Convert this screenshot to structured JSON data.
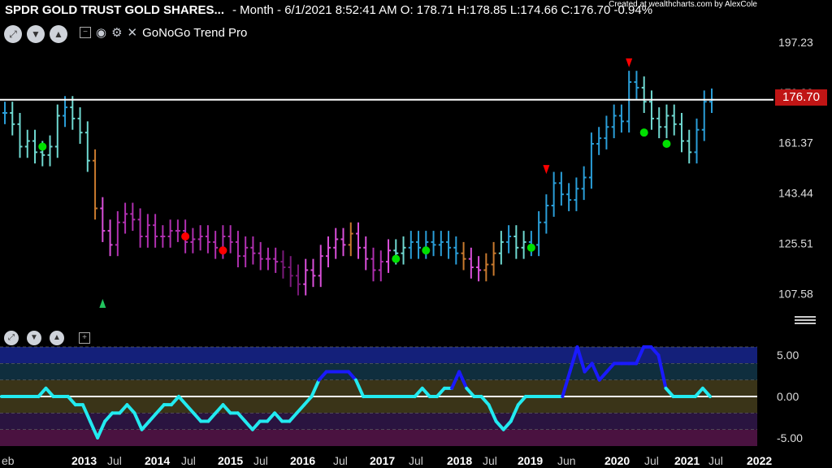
{
  "header": {
    "symbol": "SPDR GOLD TRUST GOLD SHARES...",
    "info": "- Month - 6/1/2021 8:52:41 AM O: 178.71 H:178.85 L:174.66 C:176.70 -0.94%",
    "credit": "Created at wealthcharts.com by AlexCole"
  },
  "toolbar": {
    "study_name": "GoNoGo Trend Pro"
  },
  "price_label": "176.70",
  "chart_data": {
    "type": "bar",
    "title": "",
    "x_ticks": [
      "eb",
      "2013",
      "Jul",
      "2014",
      "Jul",
      "2015",
      "Jul",
      "2016",
      "Jul",
      "2017",
      "Jul",
      "2018",
      "Jul",
      "2019",
      "Jun",
      "2020",
      "Jul",
      "2021",
      "Jul",
      "2022"
    ],
    "price_axis": {
      "ticks": [
        "197.23",
        "179.30",
        "161.37",
        "143.44",
        "125.51",
        "107.58"
      ],
      "ylim": [
        95,
        205
      ]
    },
    "reference_price": 176.7,
    "series": [
      {
        "values": [
          172,
          168,
          160,
          162,
          158,
          157,
          160,
          171,
          174,
          170,
          165,
          155,
          138,
          130,
          125,
          133,
          136,
          134,
          128,
          132,
          128,
          128,
          130,
          130,
          126,
          127,
          128,
          126,
          124,
          128,
          126,
          121,
          124,
          122,
          120,
          120,
          119,
          117,
          114,
          111,
          116,
          114,
          121,
          124,
          127,
          125,
          129,
          124,
          120,
          116,
          119,
          123,
          122,
          124,
          126,
          124,
          126,
          125,
          126,
          124,
          122,
          120,
          117,
          116,
          118,
          122,
          126,
          128,
          124,
          126,
          125,
          133,
          139,
          147,
          143,
          141,
          145,
          149,
          161,
          163,
          167,
          171,
          169,
          183,
          181,
          176,
          170,
          167,
          171,
          168,
          162,
          158,
          166,
          176,
          176.7
        ],
        "colors": [
          "#2a9ed8",
          "#6fd8d0",
          "#6fd8d0",
          "#6fd8d0",
          "#6fd8d0",
          "#6fd8d0",
          "#6fd8d0",
          "#6fd8d0",
          "#2a9ed8",
          "#6fd8d0",
          "#6fd8d0",
          "#6fd8d0",
          "#c97a2e",
          "#d94fd9",
          "#d94fd9",
          "#b030b0",
          "#b030b0",
          "#b030b0",
          "#b030b0",
          "#b030b0",
          "#b030b0",
          "#b030b0",
          "#b030b0",
          "#b030b0",
          "#b030b0",
          "#b030b0",
          "#b030b0",
          "#b030b0",
          "#b030b0",
          "#b030b0",
          "#b030b0",
          "#b030b0",
          "#b030b0",
          "#b030b0",
          "#b030b0",
          "#b030b0",
          "#b030b0",
          "#7a1a7a",
          "#7a1a7a",
          "#7a1a7a",
          "#d94fd9",
          "#d94fd9",
          "#d94fd9",
          "#d94fd9",
          "#d94fd9",
          "#d94fd9",
          "#c97a2e",
          "#d94fd9",
          "#d94fd9",
          "#b030b0",
          "#b030b0",
          "#d94fd9",
          "#6fd8d0",
          "#6fd8d0",
          "#2a9ed8",
          "#2a9ed8",
          "#2a9ed8",
          "#2a9ed8",
          "#2a9ed8",
          "#2a9ed8",
          "#2a9ed8",
          "#c97a2e",
          "#d94fd9",
          "#d94fd9",
          "#c97a2e",
          "#c97a2e",
          "#6fd8d0",
          "#2a9ed8",
          "#6fd8d0",
          "#6fd8d0",
          "#2a9ed8",
          "#2a9ed8",
          "#2a9ed8",
          "#2a9ed8",
          "#2a9ed8",
          "#2a9ed8",
          "#2a9ed8",
          "#2a9ed8",
          "#2a9ed8",
          "#2a9ed8",
          "#2a9ed8",
          "#2a9ed8",
          "#2a9ed8",
          "#2a9ed8",
          "#2a9ed8",
          "#6fd8d0",
          "#6fd8d0",
          "#6fd8d0",
          "#6fd8d0",
          "#6fd8d0",
          "#6fd8d0",
          "#6fd8d0",
          "#2a9ed8",
          "#2a9ed8",
          "#2a9ed8"
        ]
      }
    ],
    "markers": [
      {
        "kind": "up-triangle",
        "color": "#22c55e",
        "bar": 13,
        "price": 104
      },
      {
        "kind": "dot",
        "color": "#00e000",
        "bar": 5,
        "price": 160
      },
      {
        "kind": "dot",
        "color": "#ff0000",
        "bar": 24,
        "price": 128
      },
      {
        "kind": "dot",
        "color": "#ff0000",
        "bar": 29,
        "price": 123
      },
      {
        "kind": "dot",
        "color": "#00e000",
        "bar": 52,
        "price": 120
      },
      {
        "kind": "dot",
        "color": "#00e000",
        "bar": 56,
        "price": 123
      },
      {
        "kind": "dot",
        "color": "#00e000",
        "bar": 70,
        "price": 124
      },
      {
        "kind": "down-triangle",
        "color": "#ff0000",
        "bar": 72,
        "price": 152
      },
      {
        "kind": "down-triangle",
        "color": "#ff0000",
        "bar": 83,
        "price": 190
      },
      {
        "kind": "dot",
        "color": "#00e000",
        "bar": 85,
        "price": 165
      },
      {
        "kind": "dot",
        "color": "#00e000",
        "bar": 88,
        "price": 161
      }
    ],
    "oscillator": {
      "y_ticks": [
        "5.00",
        "0.00",
        "-5.00"
      ],
      "ylim": [
        -6,
        6
      ],
      "values": [
        0,
        0,
        0,
        0,
        0,
        0,
        1,
        0,
        0,
        0,
        -1,
        -1,
        -3,
        -5,
        -3,
        -2,
        -2,
        -1,
        -2,
        -4,
        -3,
        -2,
        -1,
        -1,
        0,
        -1,
        -2,
        -3,
        -3,
        -2,
        -1,
        -2,
        -2,
        -3,
        -4,
        -3,
        -3,
        -2,
        -3,
        -3,
        -2,
        -1,
        0,
        2,
        3,
        3,
        3,
        3,
        2,
        0,
        0,
        0,
        0,
        0,
        0,
        0,
        0,
        1,
        0,
        0,
        1,
        1,
        3,
        1,
        0,
        0,
        -1,
        -3,
        -4,
        -3,
        -1,
        0,
        0,
        0,
        0,
        0,
        0,
        3,
        6,
        3,
        4,
        2,
        3,
        4,
        4,
        4,
        4,
        6,
        6,
        5,
        1,
        0,
        0,
        0,
        0,
        1,
        0
      ],
      "colors_high": "#1a1aff",
      "colors_low": "#22eaf0",
      "bands": [
        {
          "from": 4,
          "to": 6,
          "color": "#14207a"
        },
        {
          "from": 2,
          "to": 4,
          "color": "#0f2e3e"
        },
        {
          "from": 0,
          "to": 2,
          "color": "#3a3418"
        },
        {
          "from": -2,
          "to": 0,
          "color": "#3a3418"
        },
        {
          "from": -4,
          "to": -2,
          "color": "#2a1440"
        },
        {
          "from": -6,
          "to": -4,
          "color": "#4a1240"
        }
      ]
    }
  }
}
